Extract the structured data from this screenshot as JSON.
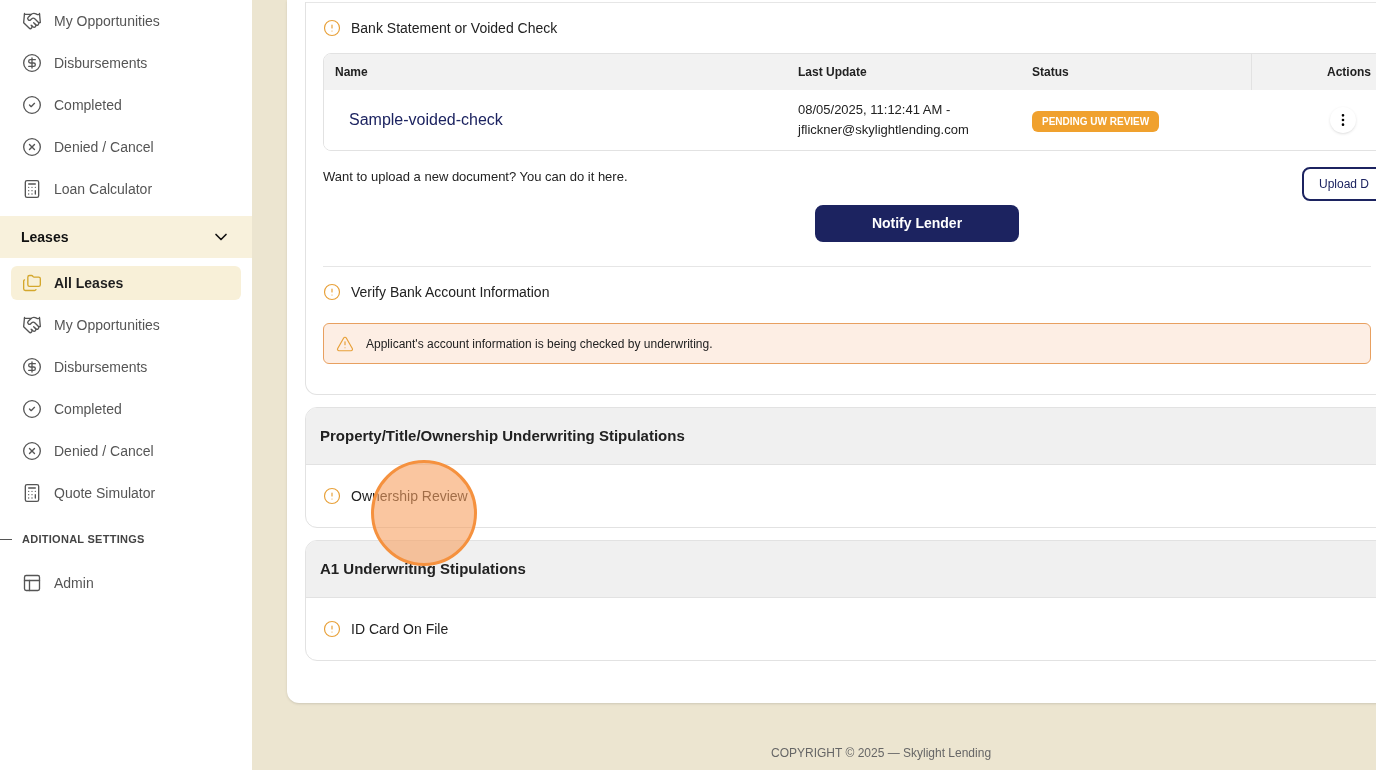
{
  "sidebar": {
    "loan_items": [
      {
        "label": "My Opportunities",
        "kind": "handshake",
        "selected": false
      },
      {
        "label": "Disbursements",
        "kind": "dollar",
        "selected": false
      },
      {
        "label": "Completed",
        "kind": "check",
        "selected": false
      },
      {
        "label": "Denied / Cancel",
        "kind": "cross",
        "selected": false
      },
      {
        "label": "Loan Calculator",
        "kind": "calculator",
        "selected": false
      }
    ],
    "leases": {
      "label": "Leases",
      "expanded": true,
      "items": [
        {
          "label": "All Leases",
          "kind": "folders",
          "selected": true
        },
        {
          "label": "My Opportunities",
          "kind": "handshake",
          "selected": false
        },
        {
          "label": "Disbursements",
          "kind": "dollar",
          "selected": false
        },
        {
          "label": "Completed",
          "kind": "check",
          "selected": false
        },
        {
          "label": "Denied / Cancel",
          "kind": "cross",
          "selected": false
        },
        {
          "label": "Quote Simulator",
          "kind": "calculator",
          "selected": false
        }
      ]
    },
    "settings_heading": "ADITIONAL SETTINGS",
    "settings_items": [
      {
        "label": "Admin",
        "kind": "layout",
        "selected": false
      }
    ]
  },
  "stipulation_groups": [
    {
      "stipulations": [
        {
          "kind": "documents",
          "title": "Bank Statement or Voided Check",
          "table": {
            "columns": [
              "Name",
              "Last Update",
              "Status",
              "Actions"
            ],
            "rows": [
              {
                "name": "Sample-voided-check",
                "last_update": "08/05/2025, 11:12:41 AM - jflickner@skylightlending.com",
                "status": "PENDING UW REVIEW"
              }
            ]
          },
          "upload_prompt": "Want to upload a new document? You can do it here.",
          "upload_button": "Upload D",
          "notify_button": "Notify Lender"
        },
        {
          "kind": "alert",
          "title": "Verify Bank Account Information",
          "message": "Applicant's account information is being checked by underwriting."
        }
      ]
    },
    {
      "title": "Property/Title/Ownership Underwriting Stipulations",
      "stipulations": [
        {
          "kind": "plain",
          "title": "Ownership Review"
        }
      ]
    },
    {
      "title": "A1 Underwriting Stipulations",
      "stipulations": [
        {
          "kind": "plain",
          "title": "ID Card On File"
        }
      ]
    }
  ],
  "footer": "COPYRIGHT © 2025 — Skylight Lending"
}
